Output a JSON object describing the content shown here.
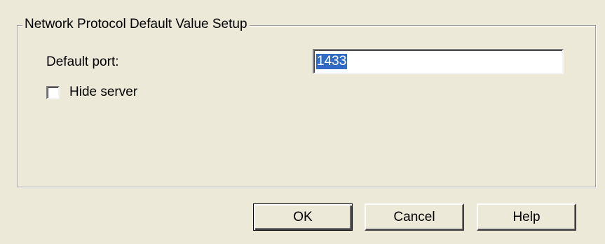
{
  "dialog": {
    "group_title": "Network Protocol Default Value Setup",
    "default_port_label": "Default port:",
    "default_port_value": "1433",
    "hide_server_label": "Hide server",
    "hide_server_checked": false
  },
  "buttons": {
    "ok_label": "OK",
    "cancel_label": "Cancel",
    "help_label": "Help"
  },
  "colors": {
    "background": "#ECE9D8",
    "selection": "#316AC5"
  }
}
